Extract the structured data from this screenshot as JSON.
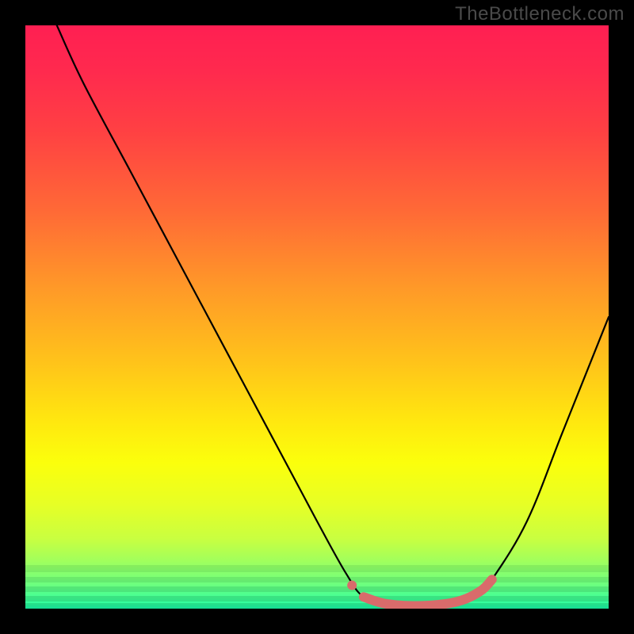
{
  "watermark": "TheBottleneck.com",
  "chart_data": {
    "type": "line",
    "title": "",
    "xlabel": "",
    "ylabel": "",
    "xlim": [
      0,
      100
    ],
    "ylim": [
      0,
      100
    ],
    "series": [
      {
        "name": "curve",
        "color": "#000000",
        "points": [
          {
            "x": 5.4,
            "y": 100
          },
          {
            "x": 10,
            "y": 90
          },
          {
            "x": 18,
            "y": 75
          },
          {
            "x": 26,
            "y": 60
          },
          {
            "x": 34,
            "y": 45
          },
          {
            "x": 42,
            "y": 30
          },
          {
            "x": 50,
            "y": 15
          },
          {
            "x": 55,
            "y": 6
          },
          {
            "x": 58,
            "y": 2
          },
          {
            "x": 62,
            "y": 0.8
          },
          {
            "x": 68,
            "y": 0.5
          },
          {
            "x": 74,
            "y": 1.2
          },
          {
            "x": 78,
            "y": 3
          },
          {
            "x": 80,
            "y": 5
          },
          {
            "x": 86,
            "y": 15
          },
          {
            "x": 92,
            "y": 30
          },
          {
            "x": 98,
            "y": 45
          },
          {
            "x": 100,
            "y": 50
          }
        ]
      },
      {
        "name": "highlight",
        "color": "#d96b6b",
        "points": [
          {
            "x": 58,
            "y": 2
          },
          {
            "x": 62,
            "y": 0.8
          },
          {
            "x": 68,
            "y": 0.5
          },
          {
            "x": 74,
            "y": 1.2
          },
          {
            "x": 78,
            "y": 3
          },
          {
            "x": 80,
            "y": 5
          }
        ],
        "dot": {
          "x": 56,
          "y": 4
        }
      }
    ],
    "gradient_stops": [
      {
        "pos": 0,
        "color": "#ff1f52"
      },
      {
        "pos": 50,
        "color": "#ffbf1c"
      },
      {
        "pos": 80,
        "color": "#f4ff15"
      },
      {
        "pos": 100,
        "color": "#1affaf"
      }
    ]
  }
}
